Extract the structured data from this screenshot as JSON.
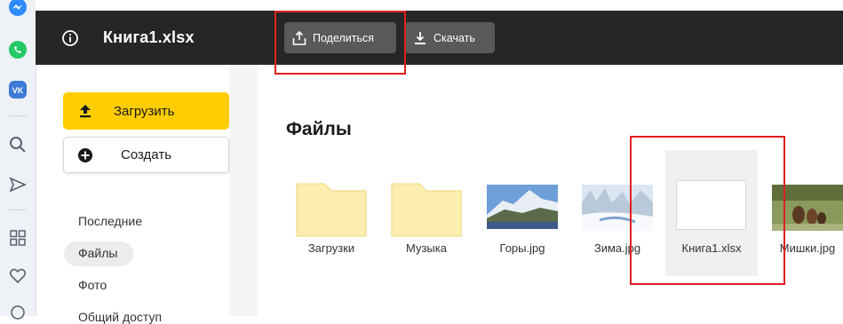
{
  "browser_panel": {
    "icons": [
      "messenger-icon",
      "whatsapp-icon",
      "vk-icon",
      "search-icon",
      "send-icon",
      "apps-icon",
      "favorites-icon"
    ]
  },
  "toolbar": {
    "file_title": "Книга1.xlsx",
    "share_label": "Поделиться",
    "download_label": "Скачать"
  },
  "sidebar": {
    "upload_label": "Загрузить",
    "create_label": "Создать",
    "items": [
      {
        "label": "Последние",
        "active": false
      },
      {
        "label": "Файлы",
        "active": true
      },
      {
        "label": "Фото",
        "active": false
      },
      {
        "label": "Общий доступ",
        "active": false
      }
    ]
  },
  "main": {
    "title": "Файлы",
    "files": [
      {
        "name": "Загрузки",
        "kind": "folder"
      },
      {
        "name": "Музыка",
        "kind": "folder"
      },
      {
        "name": "Горы.jpg",
        "kind": "image"
      },
      {
        "name": "Зима.jpg",
        "kind": "image"
      },
      {
        "name": "Книга1.xlsx",
        "kind": "spreadsheet",
        "selected": true
      },
      {
        "name": "Мишки.jpg",
        "kind": "image"
      }
    ]
  },
  "colors": {
    "toolbar_bg": "#262626",
    "upload_accent": "#ffcc00",
    "annotation_red": "#e02020",
    "folder_fill": "#fbeeb0"
  }
}
